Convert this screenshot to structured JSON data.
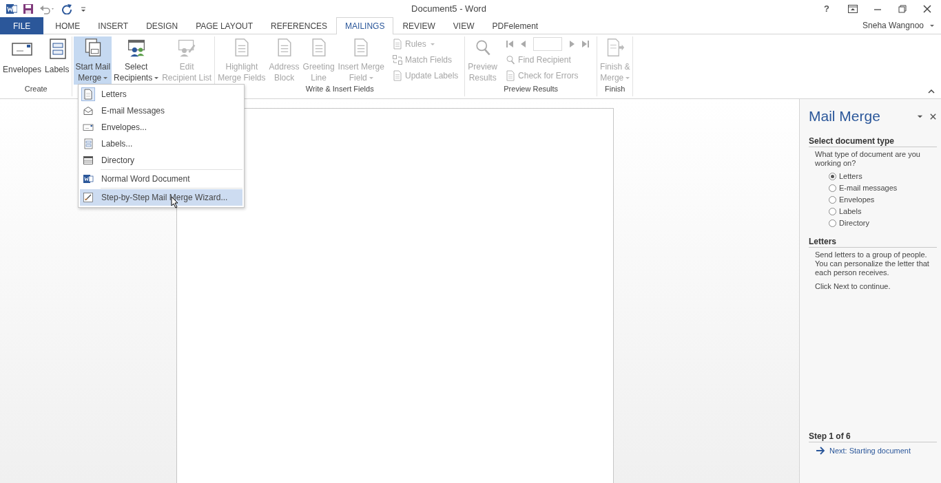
{
  "window": {
    "title": "Document5 - Word",
    "help": "?"
  },
  "tabs": [
    {
      "label": "FILE",
      "kind": "file",
      "selected": false
    },
    {
      "label": "HOME",
      "kind": "tab",
      "selected": false
    },
    {
      "label": "INSERT",
      "kind": "tab",
      "selected": false
    },
    {
      "label": "DESIGN",
      "kind": "tab",
      "selected": false
    },
    {
      "label": "PAGE LAYOUT",
      "kind": "tab",
      "selected": false
    },
    {
      "label": "REFERENCES",
      "kind": "tab",
      "selected": false
    },
    {
      "label": "MAILINGS",
      "kind": "tab",
      "selected": true
    },
    {
      "label": "REVIEW",
      "kind": "tab",
      "selected": false
    },
    {
      "label": "VIEW",
      "kind": "tab",
      "selected": false
    },
    {
      "label": "PDFelement",
      "kind": "tab",
      "selected": false
    }
  ],
  "user": {
    "name": "Sneha Wangnoo"
  },
  "ribbon": {
    "groups": [
      {
        "label": "Create",
        "items": [
          {
            "kind": "large",
            "lines": [
              "Envelopes"
            ],
            "dropdown": false,
            "disabled": false,
            "pressed": false
          },
          {
            "kind": "large",
            "lines": [
              "Labels"
            ],
            "dropdown": false,
            "disabled": false,
            "pressed": false
          }
        ]
      },
      {
        "items": [
          {
            "kind": "large",
            "lines": [
              "Start Mail",
              "Merge"
            ],
            "dropdown": true,
            "disabled": false,
            "pressed": true
          },
          {
            "kind": "large",
            "lines": [
              "Select",
              "Recipients"
            ],
            "dropdown": true,
            "disabled": false,
            "pressed": false
          },
          {
            "kind": "large",
            "lines": [
              "Edit",
              "Recipient List"
            ],
            "dropdown": false,
            "disabled": true,
            "pressed": false
          }
        ]
      },
      {
        "label": "Write & Insert Fields",
        "items": [
          {
            "kind": "large",
            "lines": [
              "Highlight",
              "Merge Fields"
            ],
            "dropdown": false,
            "disabled": true,
            "pressed": false
          },
          {
            "kind": "large",
            "lines": [
              "Address",
              "Block"
            ],
            "dropdown": false,
            "disabled": true,
            "pressed": false
          },
          {
            "kind": "large",
            "lines": [
              "Greeting",
              "Line"
            ],
            "dropdown": false,
            "disabled": true,
            "pressed": false
          },
          {
            "kind": "large",
            "lines": [
              "Insert Merge",
              "Field"
            ],
            "dropdown": true,
            "disabled": true,
            "pressed": false
          },
          {
            "kind": "column",
            "items": [
              {
                "kind": "button",
                "label": "Rules",
                "dropdown": true,
                "disabled": true
              },
              {
                "kind": "button",
                "label": "Match Fields",
                "dropdown": false,
                "disabled": true
              },
              {
                "kind": "button",
                "label": "Update Labels",
                "dropdown": false,
                "disabled": true
              }
            ]
          }
        ]
      },
      {
        "label": "Preview Results",
        "items": [
          {
            "kind": "large",
            "lines": [
              "Preview",
              "Results"
            ],
            "dropdown": false,
            "disabled": true,
            "pressed": false
          },
          {
            "kind": "column",
            "items": [
              {
                "kind": "nav",
                "disabled": true
              },
              {
                "kind": "button",
                "label": "Find Recipient",
                "dropdown": false,
                "disabled": true
              },
              {
                "kind": "button",
                "label": "Check for Errors",
                "dropdown": false,
                "disabled": true
              }
            ]
          }
        ]
      },
      {
        "label": "Finish",
        "items": [
          {
            "kind": "large",
            "lines": [
              "Finish &",
              "Merge"
            ],
            "dropdown": true,
            "disabled": true,
            "pressed": false
          }
        ]
      }
    ]
  },
  "menu": {
    "sections": [
      [
        {
          "label": "Letters",
          "checked": true,
          "highlighted": false
        },
        {
          "label": "E-mail Messages",
          "checked": false,
          "highlighted": false
        },
        {
          "label": "Envelopes...",
          "checked": false,
          "highlighted": false
        },
        {
          "label": "Labels...",
          "checked": false,
          "highlighted": false
        },
        {
          "label": "Directory",
          "checked": false,
          "highlighted": false
        }
      ],
      [
        {
          "label": "Normal Word Document",
          "checked": false,
          "highlighted": false
        }
      ],
      [
        {
          "label": "Step-by-Step Mail Merge Wizard...",
          "checked": false,
          "highlighted": true
        }
      ]
    ]
  },
  "task_pane": {
    "title": "Mail Merge",
    "section_1": {
      "heading": "Select document type",
      "question": "What type of document are you working on?",
      "options": [
        {
          "label": "Letters",
          "selected": true
        },
        {
          "label": "E-mail messages",
          "selected": false
        },
        {
          "label": "Envelopes",
          "selected": false
        },
        {
          "label": "Labels",
          "selected": false
        },
        {
          "label": "Directory",
          "selected": false
        }
      ]
    },
    "section_2": {
      "heading": "Letters",
      "description": "Send letters to a group of people. You can personalize the letter that each person receives.",
      "hint": "Click Next to continue."
    },
    "step": {
      "heading": "Step 1 of 6",
      "next_link": "Next: Starting document"
    }
  }
}
